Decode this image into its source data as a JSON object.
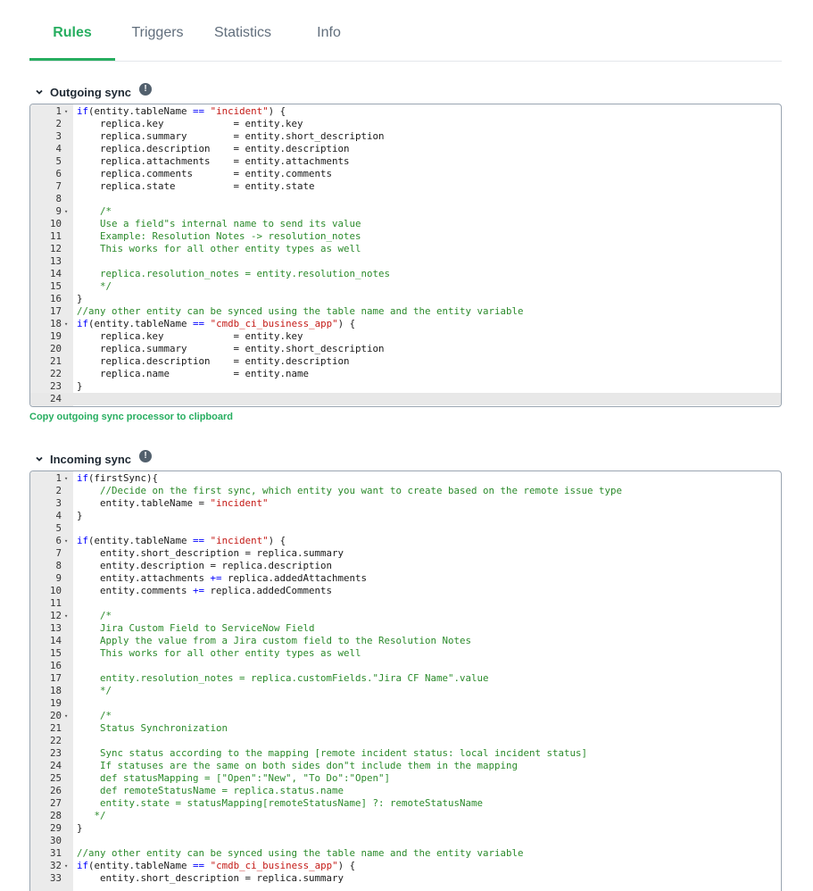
{
  "tabs": [
    {
      "label": "Rules",
      "active": true
    },
    {
      "label": "Triggers",
      "active": false
    },
    {
      "label": "Statistics",
      "active": false
    },
    {
      "label": "Info",
      "active": false
    }
  ],
  "outgoing": {
    "title": "Outgoing sync",
    "copy_label": "Copy outgoing sync processor to clipboard",
    "lines": [
      {
        "n": "1",
        "fold": true,
        "code": "if(entity.tableName == \"incident\") {"
      },
      {
        "n": "2",
        "code": "    replica.key            = entity.key"
      },
      {
        "n": "3",
        "code": "    replica.summary        = entity.short_description"
      },
      {
        "n": "4",
        "code": "    replica.description    = entity.description"
      },
      {
        "n": "5",
        "code": "    replica.attachments    = entity.attachments"
      },
      {
        "n": "6",
        "code": "    replica.comments       = entity.comments"
      },
      {
        "n": "7",
        "code": "    replica.state          = entity.state"
      },
      {
        "n": "8",
        "code": ""
      },
      {
        "n": "9",
        "fold": true,
        "code": "    /*"
      },
      {
        "n": "10",
        "code": "    Use a field\"s internal name to send its value"
      },
      {
        "n": "11",
        "code": "    Example: Resolution Notes -> resolution_notes"
      },
      {
        "n": "12",
        "code": "    This works for all other entity types as well"
      },
      {
        "n": "13",
        "code": ""
      },
      {
        "n": "14",
        "code": "    replica.resolution_notes = entity.resolution_notes"
      },
      {
        "n": "15",
        "code": "    */"
      },
      {
        "n": "16",
        "code": "}"
      },
      {
        "n": "17",
        "code": "//any other entity can be synced using the table name and the entity variable"
      },
      {
        "n": "18",
        "fold": true,
        "code": "if(entity.tableName == \"cmdb_ci_business_app\") {"
      },
      {
        "n": "19",
        "code": "    replica.key            = entity.key"
      },
      {
        "n": "20",
        "code": "    replica.summary        = entity.short_description"
      },
      {
        "n": "21",
        "code": "    replica.description    = entity.description"
      },
      {
        "n": "22",
        "code": "    replica.name           = entity.name"
      },
      {
        "n": "23",
        "code": "}"
      },
      {
        "n": "24",
        "code": "",
        "active": true
      }
    ]
  },
  "incoming": {
    "title": "Incoming sync",
    "lines": [
      {
        "n": "1",
        "fold": true,
        "code": "if(firstSync){"
      },
      {
        "n": "2",
        "code": "    //Decide on the first sync, which entity you want to create based on the remote issue type"
      },
      {
        "n": "3",
        "code": "    entity.tableName = \"incident\""
      },
      {
        "n": "4",
        "code": "}"
      },
      {
        "n": "5",
        "code": ""
      },
      {
        "n": "6",
        "fold": true,
        "code": "if(entity.tableName == \"incident\") {"
      },
      {
        "n": "7",
        "code": "    entity.short_description = replica.summary"
      },
      {
        "n": "8",
        "code": "    entity.description = replica.description"
      },
      {
        "n": "9",
        "code": "    entity.attachments += replica.addedAttachments"
      },
      {
        "n": "10",
        "code": "    entity.comments += replica.addedComments"
      },
      {
        "n": "11",
        "code": ""
      },
      {
        "n": "12",
        "fold": true,
        "code": "    /*"
      },
      {
        "n": "13",
        "code": "    Jira Custom Field to ServiceNow Field"
      },
      {
        "n": "14",
        "code": "    Apply the value from a Jira custom field to the Resolution Notes"
      },
      {
        "n": "15",
        "code": "    This works for all other entity types as well"
      },
      {
        "n": "16",
        "code": ""
      },
      {
        "n": "17",
        "code": "    entity.resolution_notes = replica.customFields.\"Jira CF Name\".value"
      },
      {
        "n": "18",
        "code": "    */"
      },
      {
        "n": "19",
        "code": ""
      },
      {
        "n": "20",
        "fold": true,
        "code": "    /*"
      },
      {
        "n": "21",
        "code": "    Status Synchronization"
      },
      {
        "n": "22",
        "code": ""
      },
      {
        "n": "23",
        "code": "    Sync status according to the mapping [remote incident status: local incident status]"
      },
      {
        "n": "24",
        "code": "    If statuses are the same on both sides don\"t include them in the mapping"
      },
      {
        "n": "25",
        "code": "    def statusMapping = [\"Open\":\"New\", \"To Do\":\"Open\"]"
      },
      {
        "n": "26",
        "code": "    def remoteStatusName = replica.status.name"
      },
      {
        "n": "27",
        "code": "    entity.state = statusMapping[remoteStatusName] ?: remoteStatusName"
      },
      {
        "n": "28",
        "code": "   */"
      },
      {
        "n": "29",
        "code": "}"
      },
      {
        "n": "30",
        "code": ""
      },
      {
        "n": "31",
        "code": "//any other entity can be synced using the table name and the entity variable"
      },
      {
        "n": "32",
        "fold": true,
        "code": "if(entity.tableName == \"cmdb_ci_business_app\") {"
      },
      {
        "n": "33",
        "code": "    entity.short_description = replica.summary"
      }
    ]
  },
  "colors": {
    "accent": "#27ae60",
    "keyword": "#0000ff",
    "string": "#c41a16",
    "comment": "#2b8a2b"
  },
  "icons": {
    "collapse": "chevron-down-icon",
    "info": "info-icon",
    "fold": "fold-arrow-icon"
  }
}
